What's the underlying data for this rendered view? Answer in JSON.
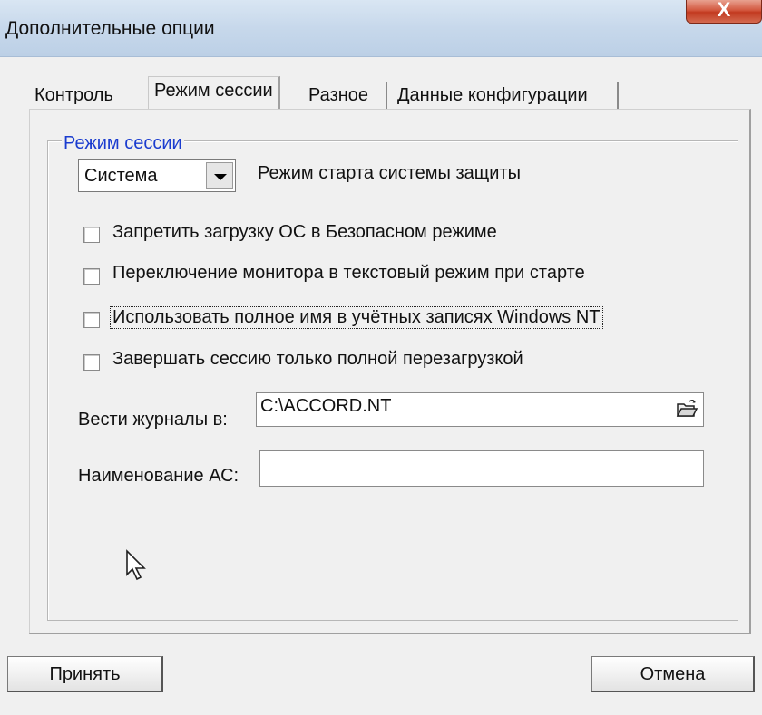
{
  "window": {
    "title": "Дополнительные опции",
    "close_glyph": "X"
  },
  "tabs": [
    {
      "label": "Контроль",
      "active": false
    },
    {
      "label": "Режим сессии",
      "active": true
    },
    {
      "label": "Разное",
      "active": false
    },
    {
      "label": "Данные конфигурации",
      "active": false
    }
  ],
  "session": {
    "group_title": "Режим сессии",
    "mode_select": {
      "value": "Система",
      "description": "Режим старта системы защиты"
    },
    "options": [
      {
        "label": "Запретить загрузку ОС в Безопасном режиме",
        "checked": false
      },
      {
        "label": "Переключение монитора в текстовый режим при старте",
        "checked": false
      },
      {
        "label": "Использовать полное имя в учётных записях Windows NT",
        "checked": false,
        "focused": true
      },
      {
        "label": "Завершать сессию только полной перезагрузкой",
        "checked": false
      }
    ],
    "log_label": "Вести журналы в:",
    "log_path": "C:\\ACCORD.NT",
    "system_name_label": "Наименование АС:",
    "system_name_value": ""
  },
  "buttons": {
    "apply": "Принять",
    "cancel": "Отмена"
  },
  "icons": {
    "browse": "open-folder-icon",
    "cursor": "mouse-pointer-icon",
    "dropdown": "chevron-down-icon"
  }
}
